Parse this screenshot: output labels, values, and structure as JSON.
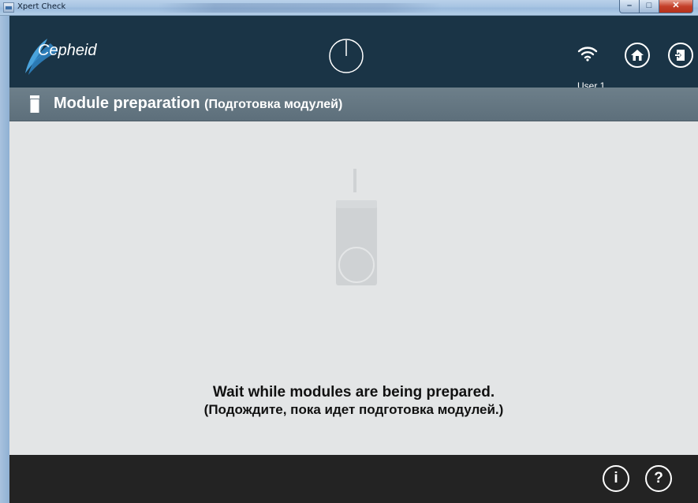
{
  "window": {
    "title": "Xpert Check"
  },
  "header": {
    "brand": "Cepheid",
    "user": "User 1",
    "icons": {
      "timer": "timer-icon",
      "wifi": "wifi-icon",
      "home": "home-icon",
      "exit": "exit-icon"
    }
  },
  "section": {
    "title": "Module preparation",
    "subtitle": "(Подготовка модулей)"
  },
  "main": {
    "message_en": "Wait while modules are being prepared.",
    "message_ru": "(Подождите, пока идет подготовка модулей.)"
  },
  "footer": {
    "info_label": "i",
    "help_label": "?"
  },
  "colors": {
    "header_bg": "#1a3446",
    "section_bg": "#6d7f8a",
    "content_bg": "#e3e5e6",
    "footer_bg": "#232323"
  }
}
